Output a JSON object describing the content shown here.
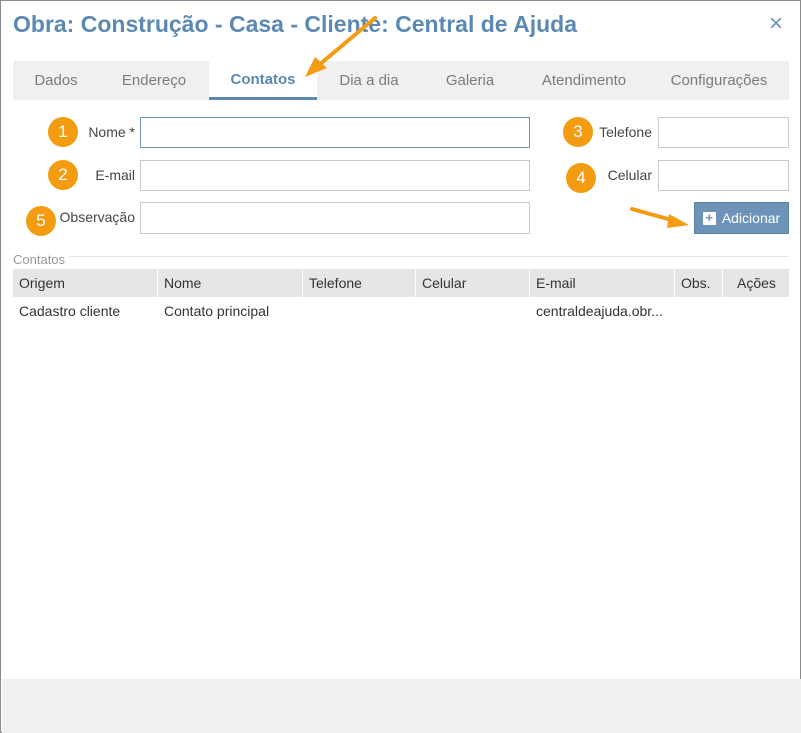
{
  "dialog": {
    "title": "Obra: Construção - Casa - Cliente: Central de Ajuda",
    "close_label": "×"
  },
  "tabs": [
    {
      "label": "Dados"
    },
    {
      "label": "Endereço"
    },
    {
      "label": "Contatos",
      "active": true
    },
    {
      "label": "Dia a dia"
    },
    {
      "label": "Galeria"
    },
    {
      "label": "Atendimento"
    },
    {
      "label": "Configurações"
    }
  ],
  "form": {
    "nome_label": "Nome *",
    "email_label": "E-mail",
    "observacao_label": "Observação",
    "telefone_label": "Telefone",
    "celular_label": "Celular",
    "nome_value": "",
    "email_value": "",
    "observacao_value": "",
    "telefone_value": "",
    "celular_value": "",
    "add_button_label": "Adicionar",
    "add_icon": "plus-square-icon"
  },
  "badges": {
    "b1": "1",
    "b2": "2",
    "b3": "3",
    "b4": "4",
    "b5": "5",
    "color": "#f39c12"
  },
  "contacts": {
    "section_title": "Contatos",
    "columns": [
      "Origem",
      "Nome",
      "Telefone",
      "Celular",
      "E-mail",
      "Obs.",
      "Ações"
    ],
    "rows": [
      {
        "origem": "Cadastro cliente",
        "nome": "Contato principal",
        "telefone": "",
        "celular": "",
        "email": "centraldeajuda.obr...",
        "obs": "",
        "acoes": ""
      }
    ]
  },
  "colors": {
    "accent": "#5b89b4",
    "button": "#6d93b8",
    "annotation": "#f39c12"
  }
}
